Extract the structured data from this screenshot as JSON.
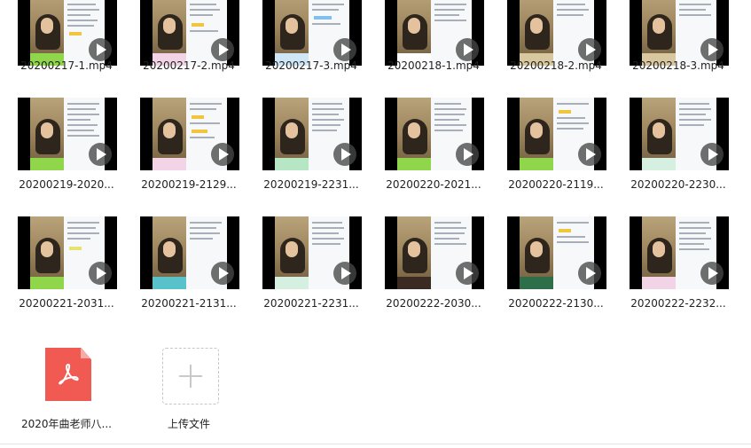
{
  "files": [
    {
      "name": "20200217-1.mp4",
      "kind": "video"
    },
    {
      "name": "20200217-2.mp4",
      "kind": "video"
    },
    {
      "name": "20200217-3.mp4",
      "kind": "video"
    },
    {
      "name": "20200218-1.mp4",
      "kind": "video"
    },
    {
      "name": "20200218-2.mp4",
      "kind": "video"
    },
    {
      "name": "20200218-3.mp4",
      "kind": "video"
    },
    {
      "name": "20200219-2020...",
      "kind": "video"
    },
    {
      "name": "20200219-2129...",
      "kind": "video"
    },
    {
      "name": "20200219-2231...",
      "kind": "video"
    },
    {
      "name": "20200220-2021...",
      "kind": "video"
    },
    {
      "name": "20200220-2119...",
      "kind": "video"
    },
    {
      "name": "20200220-2230...",
      "kind": "video"
    },
    {
      "name": "20200221-2031...",
      "kind": "video"
    },
    {
      "name": "20200221-2131...",
      "kind": "video"
    },
    {
      "name": "20200221-2231...",
      "kind": "video"
    },
    {
      "name": "20200222-2030...",
      "kind": "video"
    },
    {
      "name": "20200222-2130...",
      "kind": "video"
    },
    {
      "name": "20200222-2232...",
      "kind": "video"
    },
    {
      "name": "2020年曲老师八...",
      "kind": "pdf"
    }
  ],
  "upload": {
    "label": "上传文件",
    "icon": "plus-icon"
  },
  "colors": {
    "pdf": "#f15a53",
    "play_overlay": "#464646",
    "text": "#222222"
  }
}
